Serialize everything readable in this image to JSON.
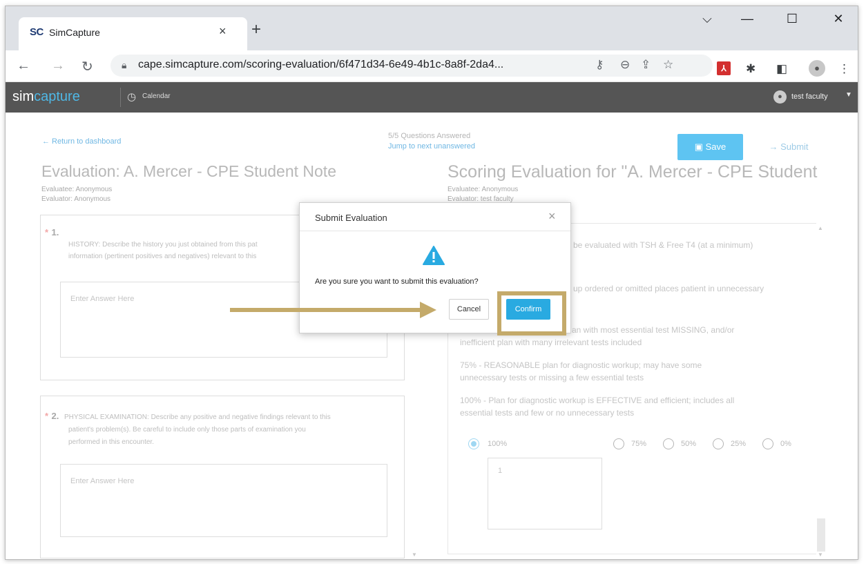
{
  "browser": {
    "tab_title": "SimCapture",
    "tab_favicon": "SC",
    "url": "cape.simcapture.com/scoring-evaluation/6f471d34-6e49-4b1c-8a8f-2da4...",
    "new_tab": "+",
    "tab_close": "×",
    "window_controls": {
      "dropdown": "⌵",
      "minimize": "—",
      "maximize": "☐",
      "close": "✕"
    }
  },
  "app_header": {
    "logo_sim": "sim",
    "logo_capture": "capture",
    "calendar_label": "Calendar",
    "user_name": "test faculty"
  },
  "page": {
    "return_link": "← Return to dashboard",
    "answered_status": "5/5 Questions Answered",
    "jump_link": "Jump to next unanswered",
    "save_label": "Save",
    "submit_label": "Submit",
    "eval_title": "Evaluation: A. Mercer - CPE Student Note",
    "evaluatee_left": "Evaluatee: Anonymous",
    "evaluator_left": "Evaluator: Anonymous",
    "score_title": "Scoring Evaluation for \"A. Mercer - CPE Student ...",
    "evaluatee_right": "Evaluatee: Anonymous",
    "evaluator_right": "Evaluator: test faculty"
  },
  "questions": [
    {
      "req": "*",
      "num": "1.",
      "text_line1": "HISTORY: Describe the history you just obtained from this pat",
      "text_line2": "information (pertinent positives and negatives) relevant to this",
      "placeholder": "Enter Answer Here"
    },
    {
      "req": "*",
      "num": "2.",
      "text_line1": "PHYSICAL EXAMINATION: Describe any positive and negative findings relevant to this",
      "text_line2": "patient's problem(s). Be careful to include only those parts of examination you",
      "text_line3": "performed in this encounter.",
      "placeholder": "Enter Answer Here"
    }
  ],
  "scoring": {
    "line1": "be evaluated with TSH & Free T4 (at a minimum)",
    "line2": "up ordered or omitted places patient in unnecessary",
    "line3a": "an with most essential test MISSING, and/or",
    "line3b": "inefficient plan with many irrelevant tests included",
    "line4a": "75% - REASONABLE plan for diagnostic workup; may have some",
    "line4b": "unnecessary tests or missing a few essential tests",
    "line5a": "100% - Plan for diagnostic workup is EFFECTIVE and efficient; includes all",
    "line5b": "essential tests and few or no unnecessary tests",
    "options": [
      "100%",
      "75%",
      "50%",
      "25%",
      "0%"
    ],
    "selected": "100%",
    "score_value": "1"
  },
  "modal": {
    "title": "Submit Evaluation",
    "close": "×",
    "message": "Are you sure you want to submit this evaluation?",
    "cancel_label": "Cancel",
    "confirm_label": "Confirm"
  },
  "colors": {
    "annotation": "#c4aa6a",
    "confirm": "#29aae1",
    "header": "#555555"
  }
}
